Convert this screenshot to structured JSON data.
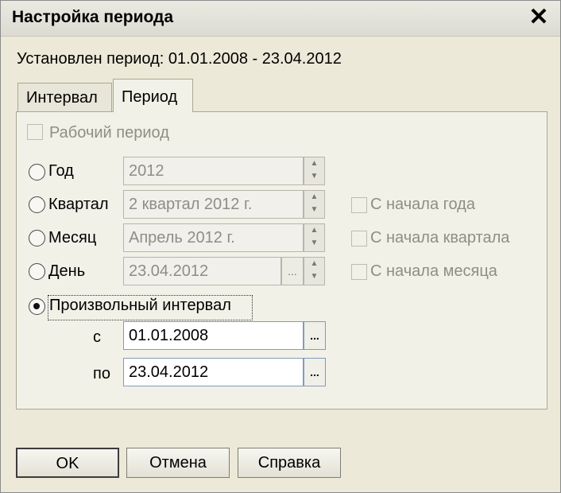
{
  "window": {
    "title": "Настройка периода"
  },
  "period_info": "Установлен период: 01.01.2008 - 23.04.2012",
  "tabs": [
    {
      "label": "Интервал"
    },
    {
      "label": "Период"
    }
  ],
  "working_period": {
    "label": "Рабочий период",
    "checked": false
  },
  "options": {
    "year": {
      "label": "Год",
      "value": "2012"
    },
    "quarter": {
      "label": "Квартал",
      "value": "2 квартал 2012 г."
    },
    "month": {
      "label": "Месяц",
      "value": "Апрель 2012 г."
    },
    "day": {
      "label": "День",
      "value": "23.04.2012"
    },
    "custom": {
      "label": "Произвольный интервал",
      "selected": true
    }
  },
  "checks": {
    "from_year": "С начала года",
    "from_quarter": "С начала квартала",
    "from_month": "С начала месяца"
  },
  "range": {
    "from_label": "с",
    "from_value": "01.01.2008",
    "to_label": "по",
    "to_value": "23.04.2012"
  },
  "picker_glyph": "...",
  "buttons": {
    "ok": "OK",
    "cancel": "Отмена",
    "help": "Справка"
  }
}
